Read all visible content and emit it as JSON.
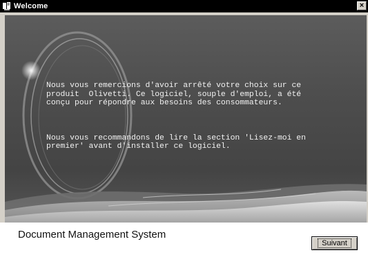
{
  "window": {
    "title": "Welcome",
    "close_label": "×",
    "icon": "app-icon"
  },
  "banner": {
    "paragraphs": [
      "Nous vous remercions d'avoir arrêté votre choix sur ce\nproduit  Olivetti. Ce logiciel, souple d'emploi, a été\nconçu pour répondre aux besoins des consommateurs.",
      "Nous vous recommandons de lire la section 'Lisez-moi en\npremier' avant d'installer ce logiciel."
    ]
  },
  "footer": {
    "product_name": "Document Management System",
    "next_button_label": "Suivant"
  },
  "colors": {
    "titlebar": "#000000",
    "banner": "#4d4d4d",
    "text": "#f2f2f2",
    "button_face": "#d4d0c8"
  }
}
